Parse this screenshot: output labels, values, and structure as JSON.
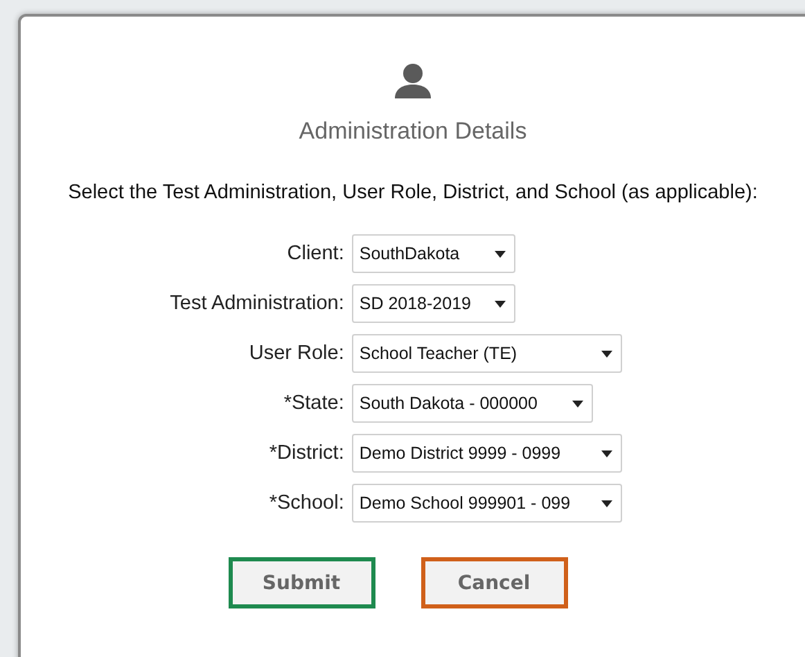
{
  "dialog": {
    "title": "Administration Details",
    "instruction": "Select the Test Administration, User Role, District, and School (as applicable):",
    "fields": [
      {
        "label": "Client:",
        "value": "SouthDakota"
      },
      {
        "label": "Test Administration:",
        "value": "SD 2018-2019"
      },
      {
        "label": "User Role:",
        "value": "School Teacher (TE)"
      },
      {
        "label": "*State:",
        "value": "South Dakota - 000000"
      },
      {
        "label": "*District:",
        "value": "Demo District 9999 - 0999"
      },
      {
        "label": "*School:",
        "value": "Demo School 999901 - 099"
      }
    ],
    "buttons": [
      {
        "label": "Submit",
        "color": "#1e8a4f"
      },
      {
        "label": "Cancel",
        "color": "#d0601a"
      }
    ]
  }
}
